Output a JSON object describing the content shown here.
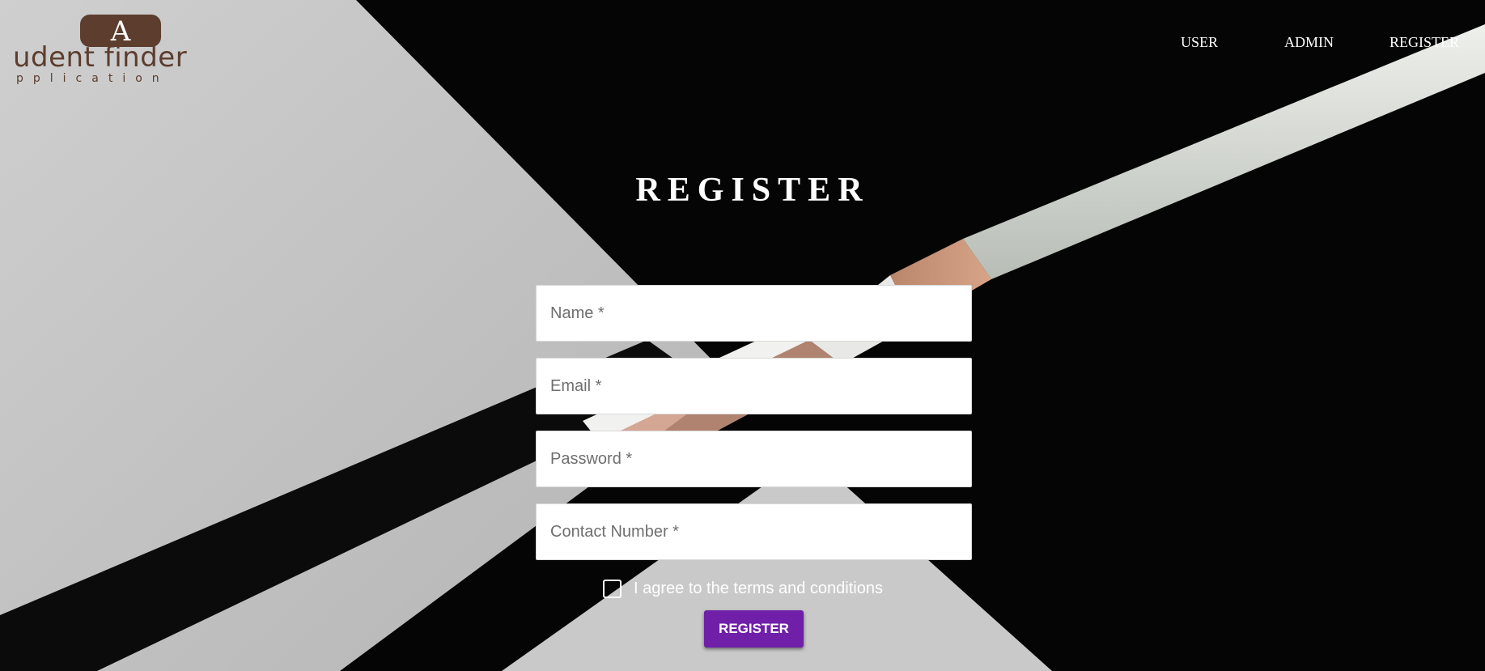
{
  "logo": {
    "badge_glyph": "A",
    "line1": "udent finder",
    "line2": "pplication",
    "color": "#5c3d2e"
  },
  "nav": {
    "items": [
      "USER",
      "ADMIN",
      "REGISTER"
    ]
  },
  "page": {
    "title": "REGISTER"
  },
  "form": {
    "fields": [
      {
        "placeholder": "Name *",
        "value": ""
      },
      {
        "placeholder": "Email *",
        "value": ""
      },
      {
        "placeholder": "Password *",
        "value": ""
      },
      {
        "placeholder": "Contact Number *",
        "value": ""
      }
    ],
    "agree_label": "I agree to the terms and conditions",
    "agree_checked": false,
    "submit_label": "REGISTER",
    "submit_color": "#6f1fa8"
  }
}
